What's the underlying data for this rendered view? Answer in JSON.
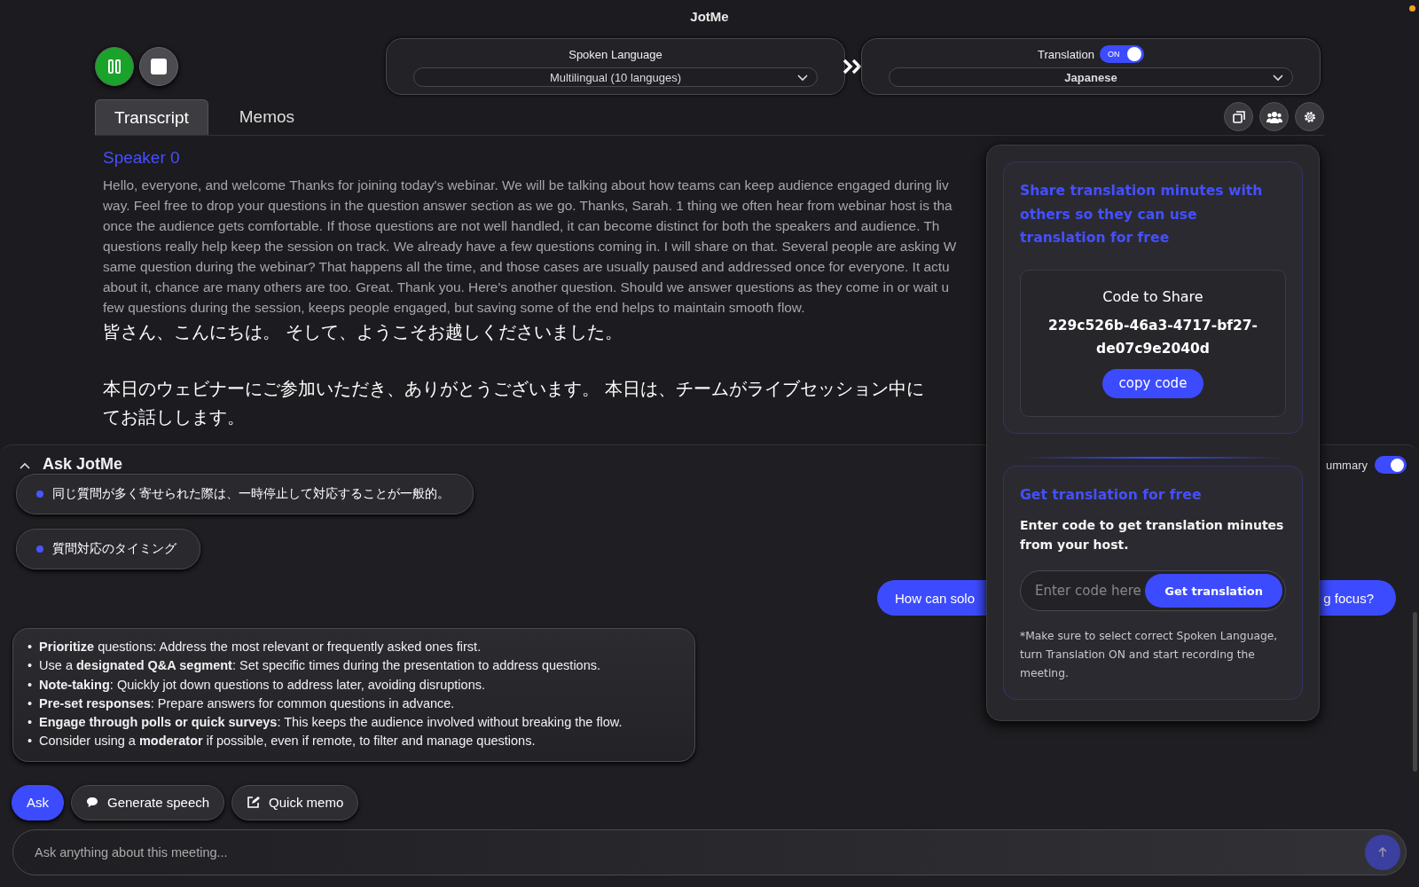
{
  "window": {
    "title": "JotMe"
  },
  "controls": [
    {
      "kind": "pause"
    },
    {
      "kind": "stop"
    }
  ],
  "spoken_language": {
    "label": "Spoken Language",
    "value": "Multilingual (10 languges)"
  },
  "translation": {
    "label": "Translation",
    "toggle": {
      "text": "ON",
      "on": true
    },
    "value": "Japanese"
  },
  "tabs": [
    {
      "label": "Transcript",
      "selected": true
    },
    {
      "label": "Memos",
      "selected": false
    }
  ],
  "toolbar": [
    {
      "kind": "copy"
    },
    {
      "kind": "people"
    },
    {
      "kind": "settings"
    }
  ],
  "transcript": {
    "speaker": "Speaker 0",
    "lines": [
      "Hello, everyone, and welcome Thanks for joining today's webinar. We will be talking about how teams can keep audience engaged during liv",
      "way. Feel free to drop your questions in the question answer section as we go. Thanks, Sarah. 1 thing we often hear from webinar host is tha",
      "once the audience gets comfortable. If those questions are not well handled, it can become distinct for both the speakers and audience. Th",
      "questions really help keep the session on track. We already have a few questions coming in. I will share on that. Several people are asking W",
      "same question during the webinar? That happens all the time, and those cases are usually paused and addressed once for everyone. It actu",
      "about it, chance are many others are too. Great. Thank you. Here's another question. Should we answer questions as they come in or wait u",
      "few questions during the session, keeps people engaged, but saving some of the end helps to maintain smooth flow."
    ],
    "translation_paragraphs": [
      [
        "皆さん、こんにちは。 そして、ようこそお越しくださいました。"
      ],
      [
        "本日のウェビナーにご参加いただき、ありがとうございます。 本日は、チームがライブセッション中に",
        "てお話しします。"
      ]
    ]
  },
  "ask_panel": {
    "title": "Ask JotMe",
    "expanded": true,
    "summary_toggle": {
      "label": "ummary",
      "on": true
    },
    "topics": [
      "同じ質問が多く寄せられた際は、一時停止して対応することが一般的。",
      "質問対応のタイミング"
    ],
    "user_message": {
      "parts": [
        "How can solo",
        "g focus?"
      ]
    },
    "answer": [
      {
        "marker": "•",
        "text": "**Prioritize** questions: Address the most relevant or frequently asked ones first."
      },
      {
        "marker": "•",
        "text": "Use a **designated Q&A segment**: Set specific times during the presentation to address questions."
      },
      {
        "marker": "•",
        "text": "**Note-taking**: Quickly jot down questions to address later, avoiding disruptions."
      },
      {
        "marker": "•",
        "text": "**Pre-set responses**: Prepare answers for common questions in advance."
      },
      {
        "marker": "•",
        "text": "**Engage through polls or quick surveys**: This keeps the audience involved without breaking the flow."
      },
      {
        "marker": "•",
        "text": "Consider using a **moderator** if possible, even if remote, to filter and manage questions."
      }
    ],
    "actions": [
      {
        "kind": "ask",
        "label": "Ask",
        "selected": true
      },
      {
        "kind": "speech",
        "label": "Generate speech",
        "selected": false
      },
      {
        "kind": "memo",
        "label": "Quick memo",
        "selected": false
      }
    ],
    "input": {
      "placeholder": "Ask anything about this meeting..."
    }
  },
  "share_popup": {
    "share": {
      "title": "Share translation minutes with others so they can use translation for free",
      "code_label": "Code to Share",
      "code": "229c526b-46a3-4717-bf27-de07c9e2040d",
      "button": "copy code"
    },
    "redeem": {
      "title": "Get translation for free",
      "subtitle": "Enter code to get translation minutes from your host.",
      "placeholder": "Enter code here",
      "button": "Get translation",
      "note": "*Make sure to select correct Spoken Language, turn Translation ON and start recording the meeting."
    }
  }
}
